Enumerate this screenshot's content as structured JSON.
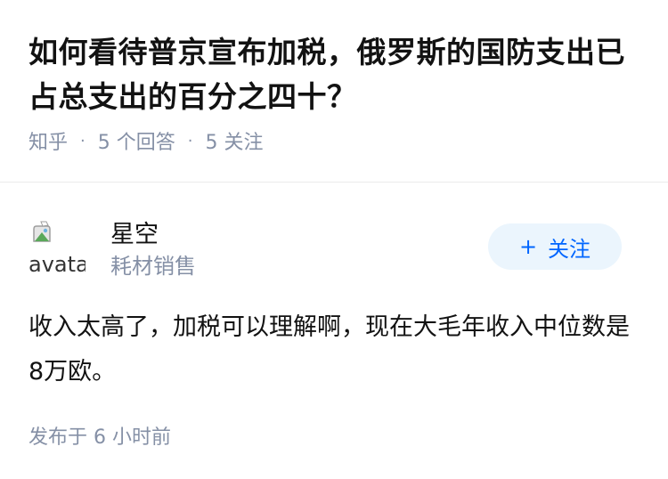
{
  "question": {
    "title": "如何看待普京宣布加税，俄罗斯的国防支出已占总支出的百分之四十？",
    "source": "知乎",
    "answers_count": "5 个回答",
    "followers_count": "5 关注"
  },
  "author": {
    "avatar_alt": "avatar",
    "name": "星空",
    "headline": "耗材销售",
    "follow_label": "关注",
    "follow_icon": "plus-icon"
  },
  "answer": {
    "content": "收入太高了，加税可以理解啊，现在大毛年收入中位数是8万欧。",
    "published": "发布于 6 小时前"
  },
  "colors": {
    "text": "#121212",
    "meta": "#8590a6",
    "accent": "#0066ff",
    "follow_bg": "#ebf5fd"
  }
}
